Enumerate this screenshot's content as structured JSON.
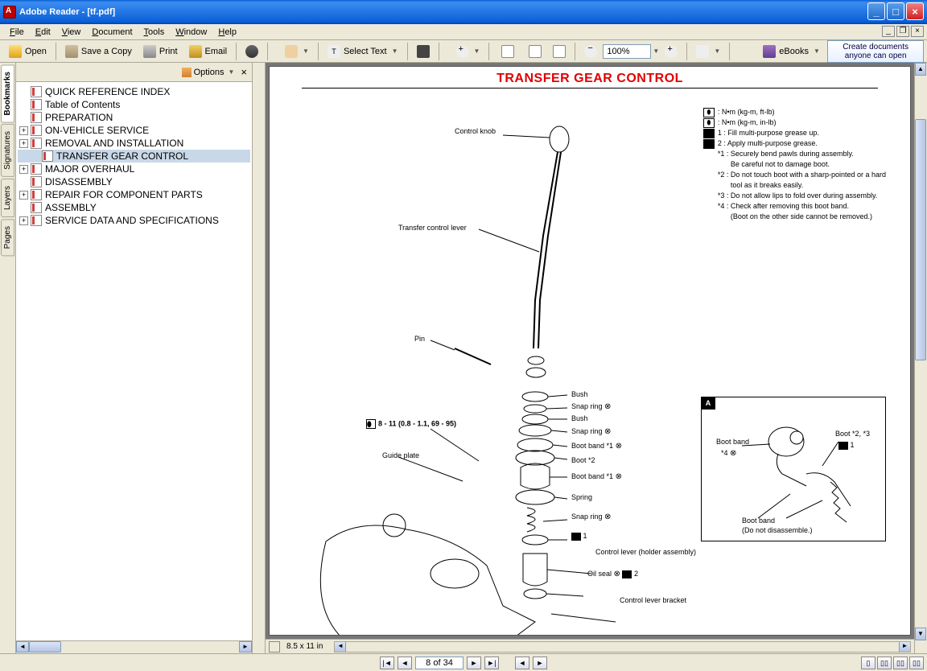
{
  "window": {
    "title": "Adobe Reader - [tf.pdf]"
  },
  "menu": {
    "file": "File",
    "edit": "Edit",
    "view": "View",
    "document": "Document",
    "tools": "Tools",
    "window": "Window",
    "help": "Help"
  },
  "toolbar": {
    "open": "Open",
    "save": "Save a Copy",
    "print": "Print",
    "email": "Email",
    "select_text": "Select Text",
    "zoom": "100%",
    "ebooks": "eBooks",
    "promo_line1": "Create documents",
    "promo_line2": "anyone can open"
  },
  "sidebar": {
    "options": "Options",
    "tabs": {
      "bookmarks": "Bookmarks",
      "signatures": "Signatures",
      "layers": "Layers",
      "pages": "Pages"
    },
    "items": [
      {
        "label": "QUICK REFERENCE INDEX",
        "expandable": false,
        "indent": 0
      },
      {
        "label": "Table of Contents",
        "expandable": false,
        "indent": 0
      },
      {
        "label": "PREPARATION",
        "expandable": false,
        "indent": 0
      },
      {
        "label": "ON-VEHICLE SERVICE",
        "expandable": true,
        "indent": 0
      },
      {
        "label": "REMOVAL AND INSTALLATION",
        "expandable": true,
        "indent": 0
      },
      {
        "label": "TRANSFER GEAR CONTROL",
        "expandable": false,
        "indent": 1,
        "selected": true
      },
      {
        "label": "MAJOR OVERHAUL",
        "expandable": true,
        "indent": 0
      },
      {
        "label": "DISASSEMBLY",
        "expandable": false,
        "indent": 0
      },
      {
        "label": "REPAIR FOR COMPONENT PARTS",
        "expandable": true,
        "indent": 0
      },
      {
        "label": "ASSEMBLY",
        "expandable": false,
        "indent": 0
      },
      {
        "label": "SERVICE DATA AND SPECIFICATIONS",
        "expandable": true,
        "indent": 0
      }
    ]
  },
  "status": {
    "page_size": "8.5 x 11 in"
  },
  "nav": {
    "page": "8 of 34"
  },
  "doc": {
    "title": "TRANSFER GEAR CONTROL",
    "legend": {
      "l1": ": N•m (kg-m, ft-lb)",
      "l2": ": N•m (kg-m, in-lb)",
      "l3": "1 : Fill multi-purpose grease up.",
      "l4": "2 : Apply multi-purpose grease.",
      "n1": "*1 : Securely bend pawls during assembly.",
      "n1b": "Be careful not to damage boot.",
      "n2": "*2 : Do not touch boot with a sharp-pointed or a hard",
      "n2b": "tool as it breaks easily.",
      "n3": "*3 : Do not allow lips to fold over during assembly.",
      "n4": "*4 : Check after removing this boot band.",
      "n4b": "(Boot on the other side cannot be removed.)"
    },
    "callouts": {
      "control_knob": "Control knob",
      "transfer_lever": "Transfer control lever",
      "pin": "Pin",
      "bush": "Bush",
      "snap_ring": "Snap ring",
      "bush2": "Bush",
      "snap_ring2": "Snap ring",
      "boot_band1": "Boot band *1",
      "boot2": "Boot *2",
      "boot_band1b": "Boot band *1",
      "spring": "Spring",
      "snap_ring3": "Snap ring",
      "ctrl_lever_holder": "Control lever (holder assembly)",
      "oil_seal": "Oil seal",
      "ctrl_lever_bracket": "Control lever bracket",
      "guide_plate": "Guide plate"
    },
    "torque": "8 - 11 (0.8 - 1.1, 69 - 95)",
    "detail": {
      "tab": "A",
      "boot_band_a": "Boot band",
      "star4": "*4",
      "boot_23": "Boot *2, *3",
      "mark1": "1",
      "boot_band_b": "Boot band",
      "no_dis": "(Do not disassemble.)"
    },
    "sym1": "1",
    "sym2": "2"
  }
}
